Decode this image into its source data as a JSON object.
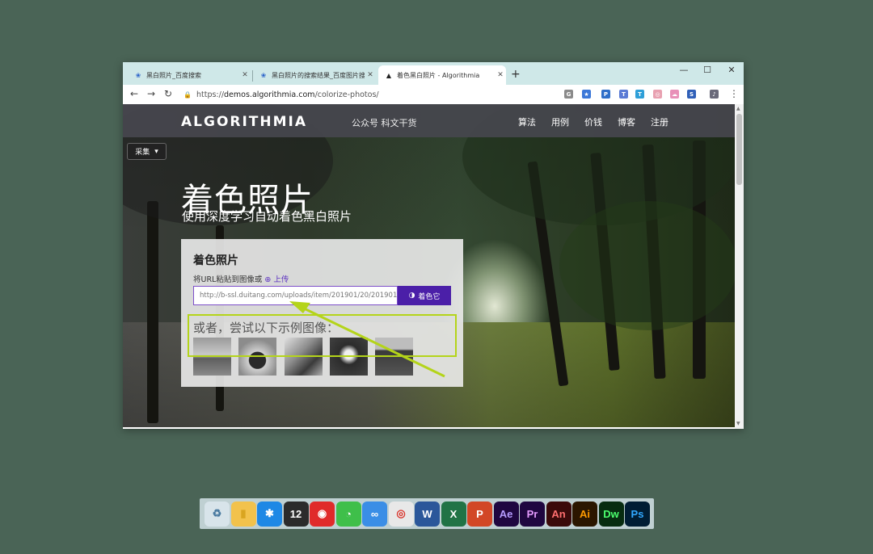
{
  "browser": {
    "tabs": [
      {
        "title": "黑白照片_百度搜索",
        "icon": "baidu-paw-icon"
      },
      {
        "title": "黑白照片的搜索结果_百度图片搜",
        "icon": "baidu-paw-icon"
      },
      {
        "title": "着色黑白照片 - Algorithmia",
        "icon": "algorithmia-logo-icon"
      }
    ],
    "new_tab": "+",
    "window_controls": {
      "minimize": "—",
      "maximize": "☐",
      "close": "✕"
    },
    "url_prefix": "https://",
    "url_host": "demos.algorithmia.com",
    "url_path": "/colorize-photos/",
    "extensions": [
      {
        "name": "translate-icon",
        "glyph": "G",
        "color": "#8a8a8a"
      },
      {
        "name": "bookmark-star-icon",
        "glyph": "★",
        "color": "#3c78d8"
      },
      {
        "name": "p-extension-icon",
        "glyph": "P",
        "color": "#2f6fc9"
      },
      {
        "name": "translate-ext-icon",
        "glyph": "T",
        "color": "#5b7bd5"
      },
      {
        "name": "t-extension-icon",
        "glyph": "T",
        "color": "#2f9fd8"
      },
      {
        "name": "circle-ext-icon",
        "glyph": "◎",
        "color": "#e8a0b0"
      },
      {
        "name": "cloud-ext-icon",
        "glyph": "☁",
        "color": "#e890b8"
      },
      {
        "name": "s-extension-icon",
        "glyph": "S",
        "color": "#3060b8"
      },
      {
        "name": "profile-icon",
        "glyph": "♪",
        "color": "#6a6a7a"
      }
    ],
    "menu_glyph": "⋮"
  },
  "site": {
    "logo": "ALGORITHMIA",
    "wechat": "公众号  科文干货",
    "nav": [
      "算法",
      "用例",
      "价钱",
      "博客",
      "注册"
    ],
    "collect_label": "采集",
    "hero_title": "着色照片",
    "hero_subtitle": "使用深度学习自动着色黑白照片",
    "panel": {
      "title": "着色照片",
      "hint_prefix": "将URL粘贴到图像或",
      "upload_label": "上传",
      "url_value": "http://b-ssl.duitang.com/uploads/item/201901/20/201901",
      "button_label": "着色它",
      "or_label": "或者，尝试以下示例图像："
    }
  },
  "taskbar": [
    {
      "name": "recycle-bin-icon",
      "label": "♻",
      "bg": "#d8e4ea",
      "fg": "#4a7aa0"
    },
    {
      "name": "folder-icon",
      "label": "▮",
      "bg": "#f2c24c",
      "fg": "#d9a520"
    },
    {
      "name": "bird-app-icon",
      "label": "✱",
      "bg": "#1e88e5",
      "fg": "#ffffff"
    },
    {
      "name": "calendar-12-icon",
      "label": "12",
      "bg": "#2b2b2b",
      "fg": "#ffffff"
    },
    {
      "name": "netease-music-icon",
      "label": "◉",
      "bg": "#e02a2a",
      "fg": "#ffffff"
    },
    {
      "name": "wechat-icon",
      "label": "◔",
      "bg": "#3fbf4a",
      "fg": "#ffffff"
    },
    {
      "name": "qq-browser-icon",
      "label": "∞",
      "bg": "#3a8ee6",
      "fg": "#ffffff"
    },
    {
      "name": "chrome-icon",
      "label": "◎",
      "bg": "#e8e8e8",
      "fg": "#d9342b"
    },
    {
      "name": "word-icon",
      "label": "W",
      "bg": "#2b579a",
      "fg": "#ffffff"
    },
    {
      "name": "excel-icon",
      "label": "X",
      "bg": "#217346",
      "fg": "#ffffff"
    },
    {
      "name": "powerpoint-icon",
      "label": "P",
      "bg": "#d24726",
      "fg": "#ffffff"
    },
    {
      "name": "after-effects-icon",
      "label": "Ae",
      "bg": "#1f0740",
      "fg": "#b69cff"
    },
    {
      "name": "premiere-icon",
      "label": "Pr",
      "bg": "#1f0740",
      "fg": "#e59cff"
    },
    {
      "name": "animate-icon",
      "label": "An",
      "bg": "#3b0a0a",
      "fg": "#ff6f6f"
    },
    {
      "name": "illustrator-icon",
      "label": "Ai",
      "bg": "#2b1600",
      "fg": "#ff9a00"
    },
    {
      "name": "dreamweaver-icon",
      "label": "Dw",
      "bg": "#072c10",
      "fg": "#4cff6e"
    },
    {
      "name": "photoshop-icon",
      "label": "Ps",
      "bg": "#001d34",
      "fg": "#31a8ff"
    }
  ]
}
